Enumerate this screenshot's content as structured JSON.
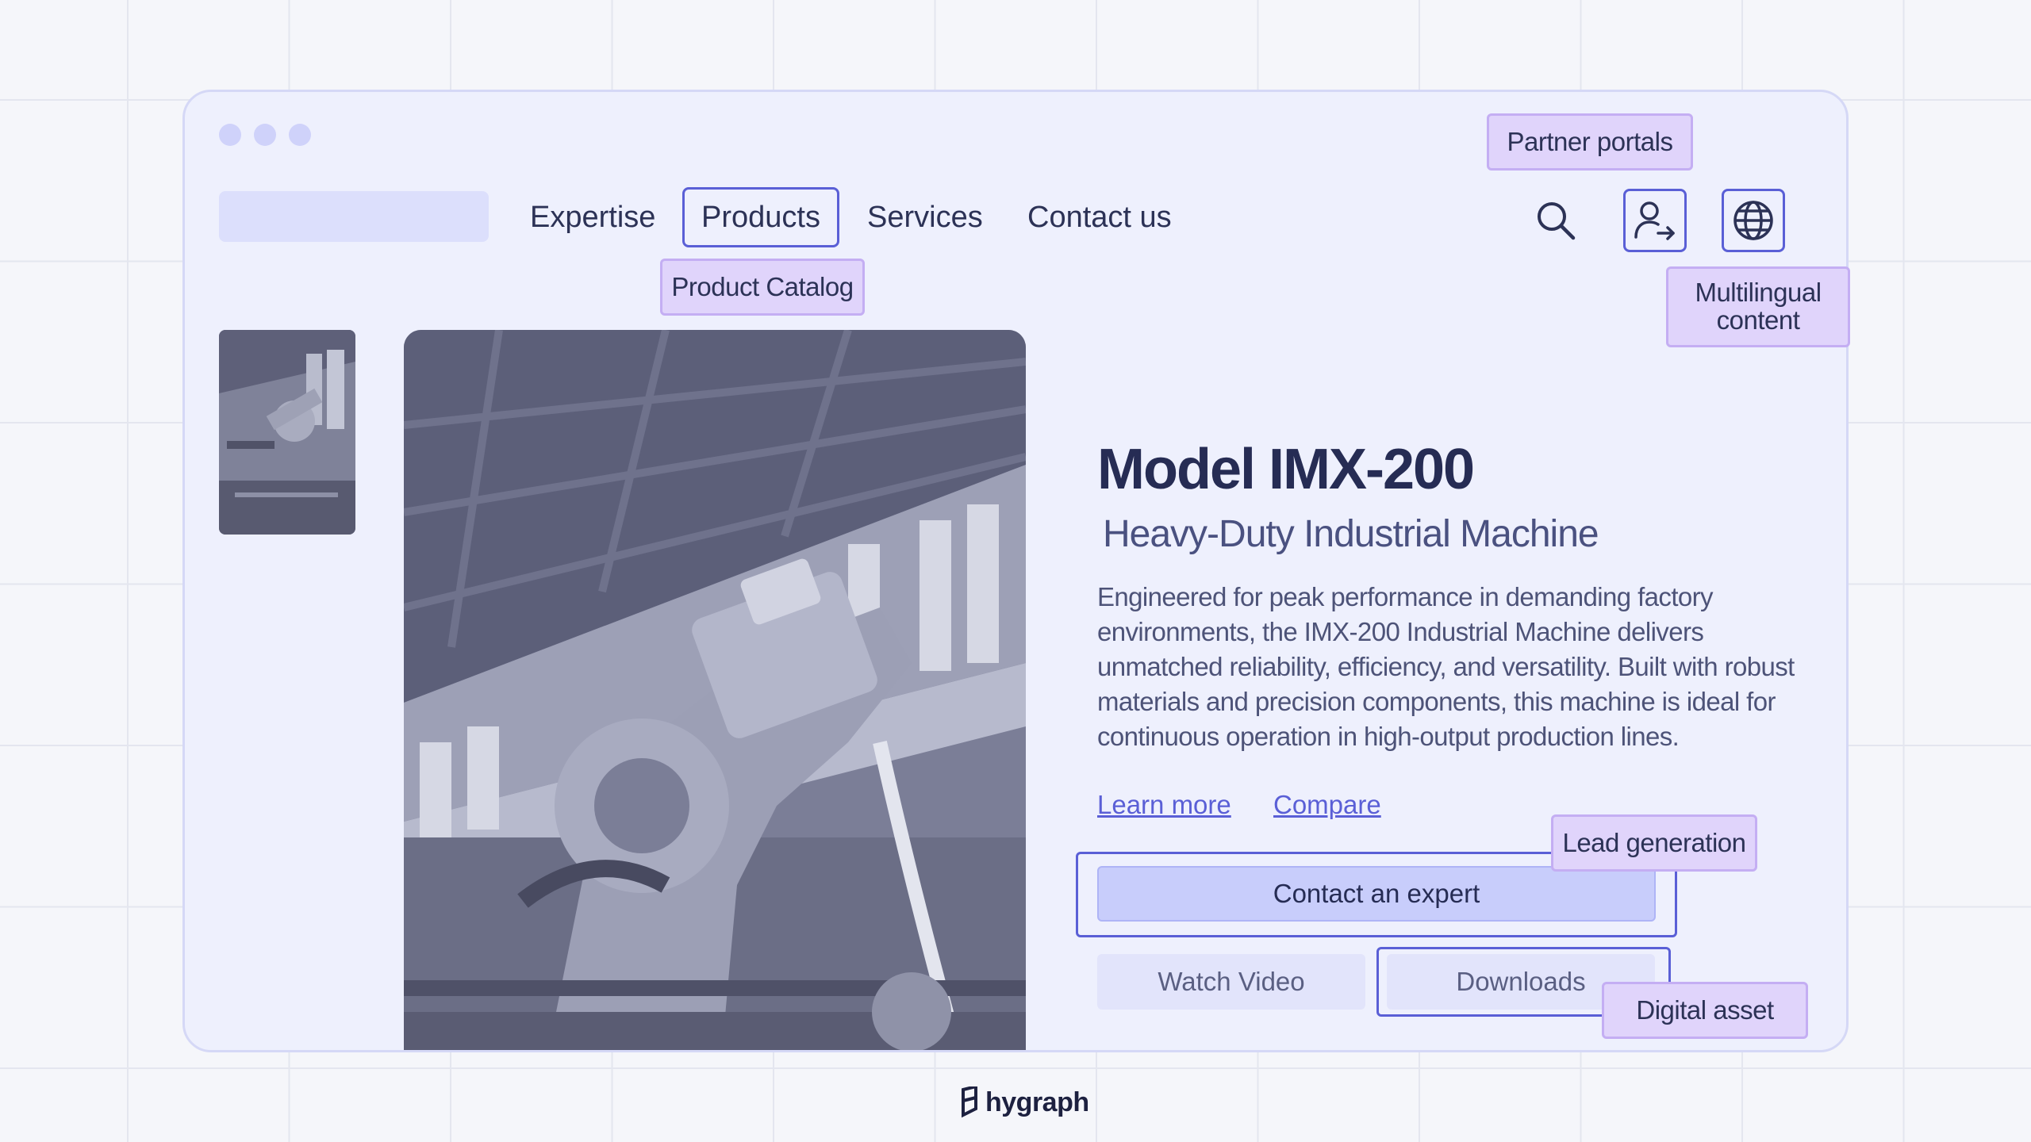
{
  "nav": {
    "items": [
      "Expertise",
      "Products",
      "Services",
      "Contact us"
    ],
    "active": "Products"
  },
  "icons": {
    "search": "search-icon",
    "partner_login": "user-login-icon",
    "language": "globe-icon"
  },
  "annotations": {
    "partner_portals": "Partner portals",
    "product_catalog": "Product Catalog",
    "multilingual_content": "Multilingual content",
    "lead_generation": "Lead generation",
    "digital_asset": "Digital asset"
  },
  "product": {
    "title": "Model IMX-200",
    "subtitle": "Heavy-Duty Industrial Machine",
    "description": "Engineered for peak performance in demanding factory environments, the IMX-200 Industrial Machine delivers unmatched reliability, efficiency, and versatility. Built with robust materials and precision components, this machine is ideal for continuous operation in high-output production lines.",
    "links": [
      "Learn more",
      "Compare"
    ],
    "cta": "Contact an expert",
    "secondary_buttons": [
      "Watch Video",
      "Downloads"
    ]
  },
  "footer": {
    "brand": "hygraph"
  },
  "colors": {
    "accent": "#5a5fd6",
    "window_bg": "#eef0fd",
    "annotation_bg": "#e0d4fb",
    "cta_bg": "#c8cdfb"
  }
}
